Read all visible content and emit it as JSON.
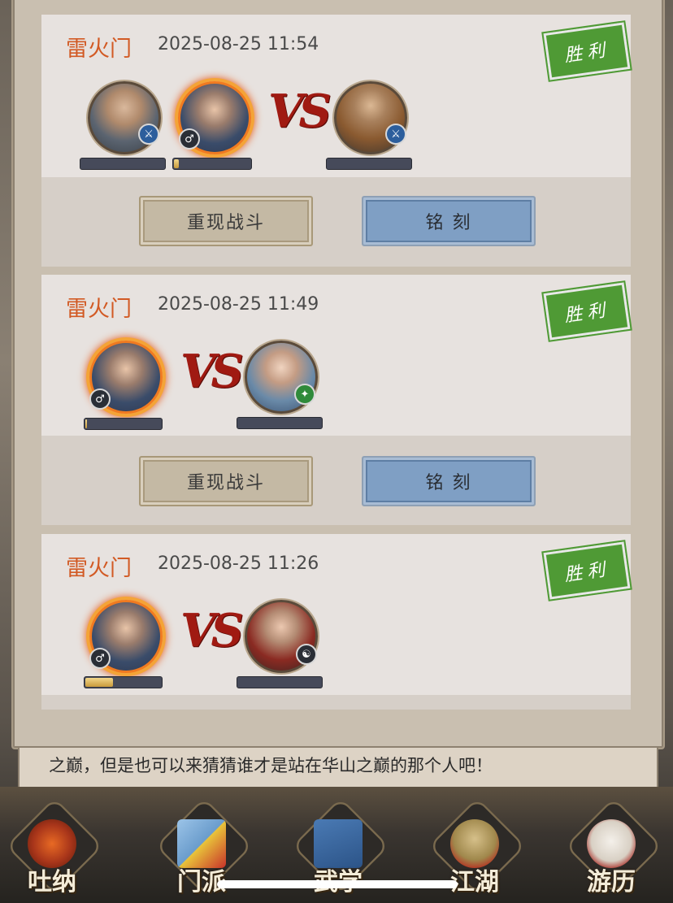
{
  "battles": [
    {
      "sect": "雷火门",
      "time": "2025-08-25 11:54",
      "result": "胜利",
      "vs": "VS",
      "replay_label": "重现战斗",
      "engrave_label": "铭 刻",
      "left_team": [
        {
          "portrait": "male-warrior",
          "badge_icon": "sword-icon",
          "hp_fraction": 0.0
        },
        {
          "portrait": "fire-hero",
          "badge_icon": "male-gender-icon",
          "hp_fraction": 0.06
        }
      ],
      "right_team": [
        {
          "portrait": "armored-male",
          "badge_icon": "sword-icon",
          "hp_fraction": 0.0
        }
      ]
    },
    {
      "sect": "雷火门",
      "time": "2025-08-25 11:49",
      "result": "胜利",
      "vs": "VS",
      "replay_label": "重现战斗",
      "engrave_label": "铭 刻",
      "left_team": [
        {
          "portrait": "fire-hero",
          "badge_icon": "male-gender-icon",
          "hp_fraction": 0.02
        }
      ],
      "right_team": [
        {
          "portrait": "female-swordswoman",
          "badge_icon": "jade-icon",
          "hp_fraction": 0.0
        }
      ]
    },
    {
      "sect": "雷火门",
      "time": "2025-08-25 11:26",
      "result": "胜利",
      "vs": "VS",
      "left_team": [
        {
          "portrait": "fire-hero",
          "badge_icon": "male-gender-icon",
          "hp_fraction": 0.36
        }
      ],
      "right_team": [
        {
          "portrait": "female-warrior",
          "badge_icon": "dark-icon",
          "hp_fraction": 0.0
        }
      ]
    }
  ],
  "story_text": "之巅，但是也可以来猜猜谁才是站在华山之巅的那个人吧！",
  "nav": [
    {
      "label": "吐纳",
      "icon": "meditation-icon"
    },
    {
      "label": "门派",
      "icon": "sect-flag-icon"
    },
    {
      "label": "武学",
      "icon": "martial-book-icon"
    },
    {
      "label": "江湖",
      "icon": "bamboo-hat-icon"
    },
    {
      "label": "游历",
      "icon": "horse-icon"
    }
  ],
  "colors": {
    "sect_text": "#d25a24",
    "win_stamp": "#4f9a35",
    "vs": "#a01a12",
    "engrave_button": "#7f9fc4"
  }
}
